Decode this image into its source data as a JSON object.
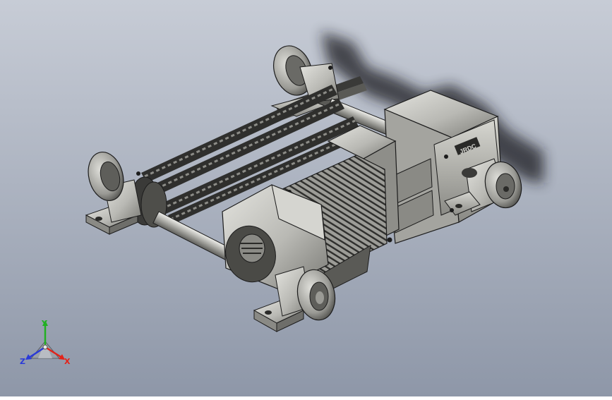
{
  "scene": {
    "background_top": "#c7ccd6",
    "background_bottom": "#8e97a8",
    "part_color": "#b9b9b4",
    "part_dark": "#6e6e6a",
    "part_light": "#e4e4df",
    "edge_color": "#1c1c1c",
    "gearbox_label": "JRDC"
  },
  "triad": {
    "y_label": "Y",
    "x_label": "X",
    "z_label": "Z",
    "x_color": "#e2231a",
    "y_color": "#22b022",
    "z_color": "#2a3ad8"
  }
}
